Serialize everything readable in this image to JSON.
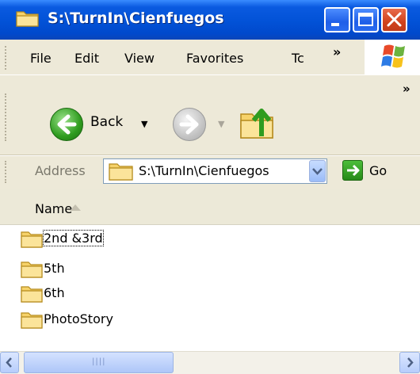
{
  "window": {
    "title": "S:\\TurnIn\\Cienfuegos"
  },
  "menu": {
    "items": [
      "File",
      "Edit",
      "View",
      "Favorites",
      "Tc"
    ],
    "overflow": "»"
  },
  "toolbar": {
    "back_label": "Back",
    "overflow": "»"
  },
  "address": {
    "label": "Address",
    "value": "S:\\TurnIn\\Cienfuegos",
    "go_label": "Go"
  },
  "list": {
    "column_header": "Name",
    "items": [
      "2nd &3rd",
      "5th",
      "6th",
      "PhotoStory"
    ],
    "selected_index": 0
  },
  "icons": [
    "folder-icon",
    "minimize-icon",
    "maximize-icon",
    "close-icon",
    "back-arrow-icon",
    "forward-arrow-icon",
    "up-folder-icon",
    "go-arrow-icon",
    "windows-logo-icon",
    "sort-ascending-icon"
  ],
  "colors": {
    "titlebar": "#0353d8",
    "toolbar_bg": "#ede9d8",
    "back_green": "#2f9c1f",
    "close_red": "#d0421c"
  }
}
